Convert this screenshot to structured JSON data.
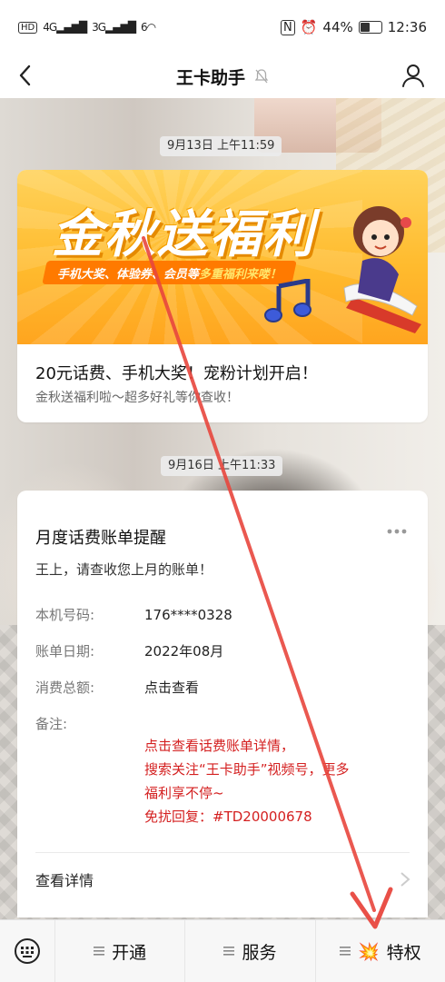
{
  "status_bar": {
    "network": "HD",
    "signal1": "4G",
    "signal2": "3G",
    "wifi": "6",
    "battery": "44%",
    "time": "12:36",
    "battery_level": 0.44
  },
  "nav": {
    "title": "王卡助手"
  },
  "messages": [
    {
      "timestamp": "9月13日 上午11:59",
      "banner_title": "金秋送福利",
      "banner_ribbon_a": "手机大奖、体验券、会员等",
      "banner_ribbon_b": "多重福利来喽！",
      "title": "20元话费、手机大奖！宠粉计划开启！",
      "subtitle": "金秋送福利啦～超多好礼等你查收！"
    },
    {
      "timestamp": "9月16日 上午11:33",
      "title": "月度话费账单提醒",
      "greeting": "王上，请查收您上月的账单！",
      "rows": [
        {
          "label": "本机号码:",
          "value": "176****0328"
        },
        {
          "label": "账单日期:",
          "value": "2022年08月"
        },
        {
          "label": "消费总额:",
          "value": "点击查看"
        },
        {
          "label": "备注:",
          "value": ""
        }
      ],
      "remark_lines": [
        "点击查看话费账单详情，",
        "搜索关注“王卡助手”视频号，更多",
        "福利享不停~",
        "免扰回复：#TD20000678"
      ],
      "detail_label": "查看详情"
    }
  ],
  "bottom_menu": [
    {
      "label": "开通"
    },
    {
      "label": "服务"
    },
    {
      "label": "特权",
      "emoji": "💥"
    }
  ],
  "colors": {
    "remark": "#d42020",
    "banner": "#ffbb2e",
    "annotation": "#e8473e"
  }
}
